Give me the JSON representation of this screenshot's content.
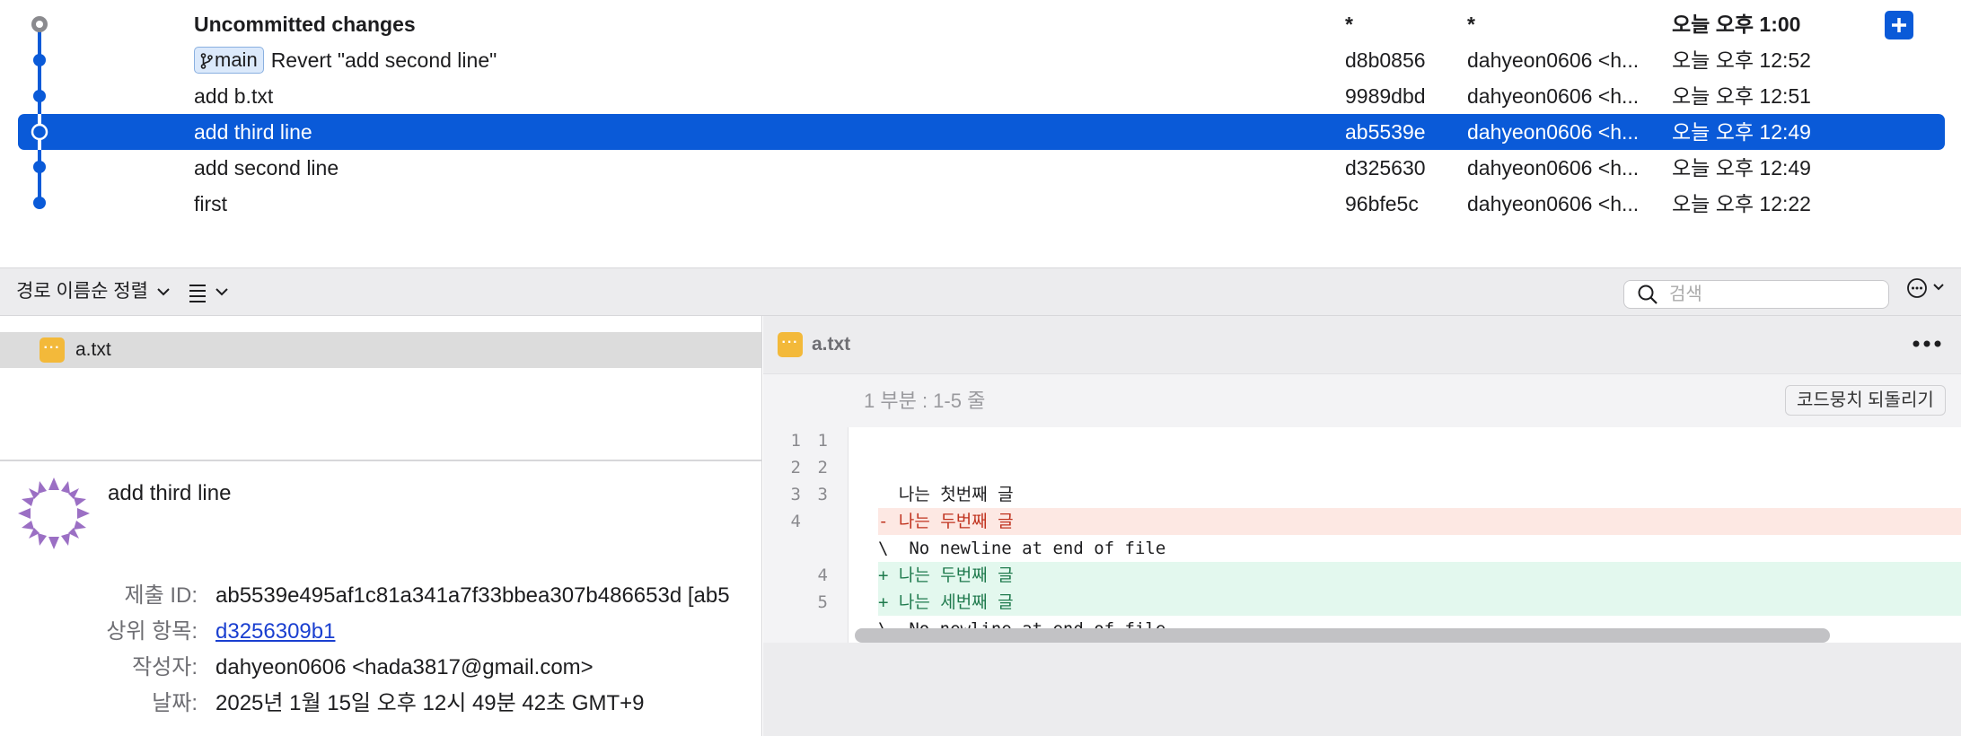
{
  "commits": [
    {
      "message": "Uncommitted changes",
      "hash": "*",
      "author": "*",
      "date": "오늘 오후 1:00"
    },
    {
      "branch": "main",
      "message": "Revert \"add second line\"",
      "hash": "d8b0856",
      "author": "dahyeon0606 <h...",
      "date": "오늘 오후 12:52"
    },
    {
      "message": "add b.txt",
      "hash": "9989dbd",
      "author": "dahyeon0606 <h...",
      "date": "오늘 오후 12:51"
    },
    {
      "message": "add third line",
      "hash": "ab5539e",
      "author": "dahyeon0606 <h...",
      "date": "오늘 오후 12:49"
    },
    {
      "message": "add second line",
      "hash": "d325630",
      "author": "dahyeon0606 <h...",
      "date": "오늘 오후 12:49"
    },
    {
      "message": "first",
      "hash": "96bfe5c",
      "author": "dahyeon0606 <h...",
      "date": "오늘 오후 12:22"
    }
  ],
  "toolbar": {
    "sort_label": "경로 이름순 정렬",
    "search_placeholder": "검색"
  },
  "files": [
    {
      "name": "a.txt",
      "status_icon": "modified-icon"
    }
  ],
  "details": {
    "title": "add third line",
    "id_label": "제출 ID:",
    "id_value": "ab5539e495af1c81a341a7f33bbea307b486653d [ab5",
    "parent_label": "상위 항목:",
    "parent_value": "d3256309b1",
    "author_label": "작성자:",
    "author_value": "dahyeon0606 <hada3817@gmail.com>",
    "date_label": "날짜:",
    "date_value": "2025년 1월 15일 오후 12시 49분 42초 GMT+9"
  },
  "diff": {
    "file_name": "a.txt",
    "hunk_label": "1 부분 : 1-5 줄",
    "revert_label": "코드뭉치 되돌리기",
    "lines": [
      {
        "type": "ctx",
        "old": "1",
        "new": "1",
        "text": ""
      },
      {
        "type": "ctx",
        "old": "2",
        "new": "2",
        "text": ""
      },
      {
        "type": "ctx",
        "old": "3",
        "new": "3",
        "text": "  나는 첫번째 글"
      },
      {
        "type": "del",
        "old": "4",
        "new": "",
        "text": "- 나는 두번째 글"
      },
      {
        "type": "meta",
        "old": "",
        "new": "",
        "text": "\\  No newline at end of file"
      },
      {
        "type": "add",
        "old": "",
        "new": "4",
        "text": "+ 나는 두번째 글"
      },
      {
        "type": "add",
        "old": "",
        "new": "5",
        "text": "+ 나는 세번째 글"
      },
      {
        "type": "meta",
        "old": "",
        "new": "",
        "text": "\\  No newline at end of file"
      }
    ]
  },
  "colors": {
    "accent": "#0a5ad8",
    "modified": "#f3b93a",
    "added_bg": "#e3f8ee",
    "removed_bg": "#fde8e3",
    "avatar": "#9b6fc4"
  }
}
